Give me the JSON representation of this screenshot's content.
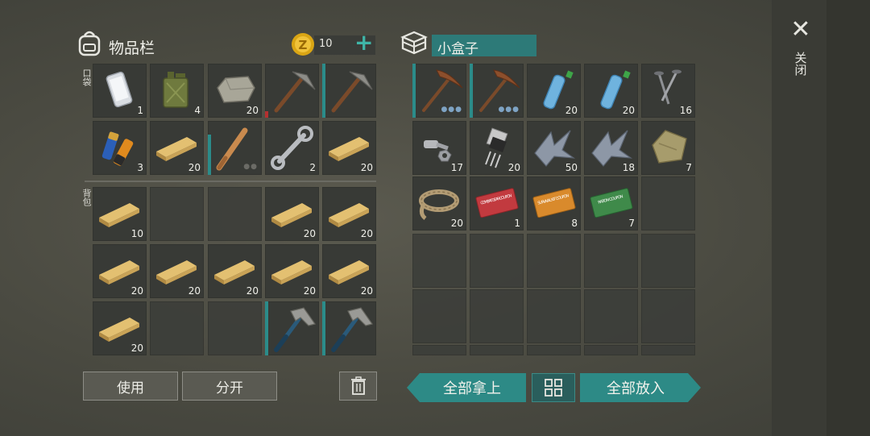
{
  "inventory": {
    "title": "物品栏",
    "coins": "10",
    "add_symbol": "+",
    "pocket_label": "口袋",
    "backpack_label": "背包"
  },
  "container": {
    "title": "小盒子"
  },
  "buttons": {
    "use": "使用",
    "split": "分开",
    "take_all": "全部拿上",
    "put_all": "全部放入"
  },
  "side": {
    "close_label": "关闭",
    "close_symbol": "✕"
  },
  "pocket_counts": [
    "1",
    "4",
    "20",
    "",
    "",
    "3",
    "20",
    "",
    "2",
    "20"
  ],
  "backpack_counts": [
    "10",
    "",
    "",
    "20",
    "20",
    "20",
    "20",
    "20",
    "20",
    "20",
    "20",
    "",
    "",
    "",
    ""
  ],
  "box_counts": [
    "",
    "",
    "20",
    "20",
    "16",
    "17",
    "20",
    "50",
    "18",
    "7",
    "20",
    "1",
    "8",
    "7",
    ""
  ],
  "coupons": {
    "combat": "COMBAT GEAR COUPON",
    "survival": "SURVIVAL KIT COUPON",
    "ration": "RATION COUPON"
  },
  "colors": {
    "accent": "#2d8a86",
    "slot": "#383a36",
    "background": "#4f4f46"
  }
}
